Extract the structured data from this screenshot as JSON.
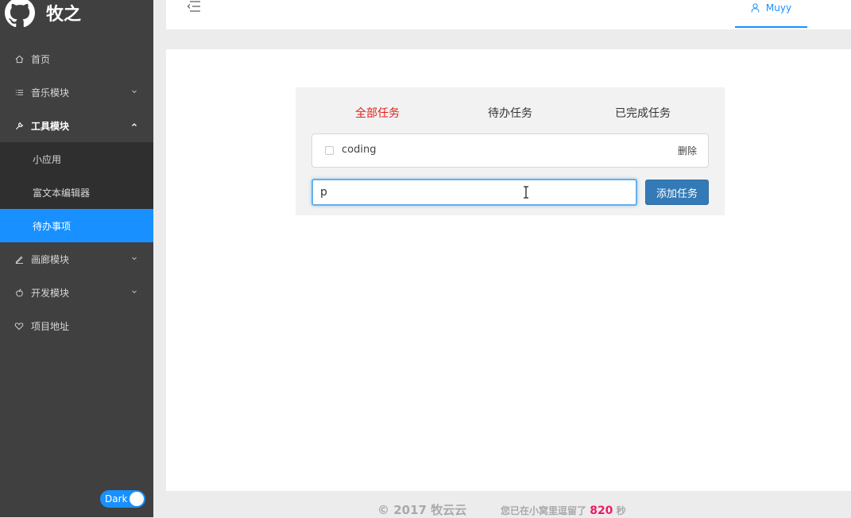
{
  "brand": {
    "name": "牧之"
  },
  "sidebar": {
    "items": [
      {
        "label": "首页",
        "icon": "home-icon"
      },
      {
        "label": "音乐模块",
        "icon": "list-icon",
        "expandable": true
      },
      {
        "label": "工具模块",
        "icon": "tool-icon",
        "expandable": true,
        "open": true,
        "children": [
          {
            "label": "小应用"
          },
          {
            "label": "富文本编辑器"
          },
          {
            "label": "待办事项",
            "active": true
          }
        ]
      },
      {
        "label": "画廊模块",
        "icon": "edit-icon",
        "expandable": true
      },
      {
        "label": "开发模块",
        "icon": "apple-icon",
        "expandable": true
      },
      {
        "label": "项目地址",
        "icon": "heart-icon"
      }
    ],
    "theme_toggle": {
      "label": "Dark",
      "on": true
    }
  },
  "header": {
    "user": "Muyy"
  },
  "todo": {
    "tabs": [
      "全部任务",
      "待办任务",
      "已完成任务"
    ],
    "active_tab": 0,
    "tasks": [
      {
        "text": "coding",
        "done": false,
        "delete_label": "删除"
      }
    ],
    "input_value": "p",
    "add_label": "添加任务"
  },
  "footer": {
    "copyright": "© 2017 牧云云",
    "stay_prefix": "您已在小窝里逗留了",
    "stay_seconds": "820",
    "stay_suffix": "秒"
  },
  "colors": {
    "sidebar_bg": "#404040",
    "submenu_bg": "#2f2f2f",
    "accent": "#1890ff",
    "active_tab": "#e4201d",
    "button": "#337ab7",
    "seconds": "#e91e63"
  }
}
